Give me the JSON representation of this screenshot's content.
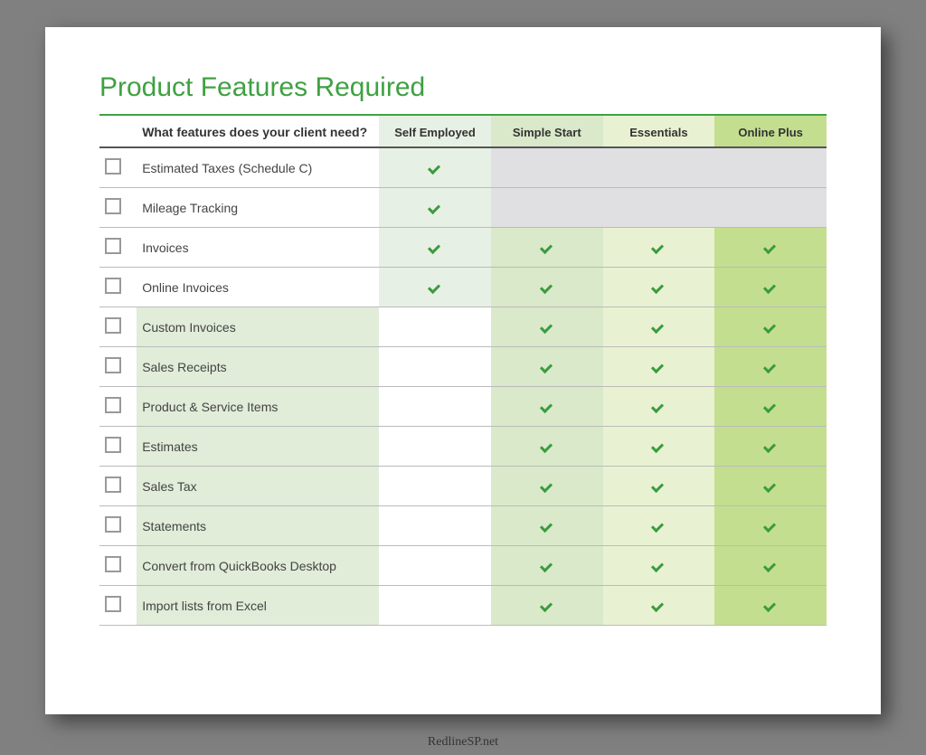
{
  "title": "Product Features Required",
  "question_header": "What features does your client need?",
  "plans": [
    "Self Employed",
    "Simple Start",
    "Essentials",
    "Online Plus"
  ],
  "features": [
    {
      "name": "Estimated Taxes (Schedule C)",
      "self": true,
      "simple": false,
      "essential": false,
      "plus": false,
      "grayAfterSelf": true,
      "featBg": false
    },
    {
      "name": "Mileage Tracking",
      "self": true,
      "simple": false,
      "essential": false,
      "plus": false,
      "grayAfterSelf": true,
      "featBg": false
    },
    {
      "name": "Invoices",
      "self": true,
      "simple": true,
      "essential": true,
      "plus": true,
      "grayAfterSelf": false,
      "featBg": false
    },
    {
      "name": "Online Invoices",
      "self": true,
      "simple": true,
      "essential": true,
      "plus": true,
      "grayAfterSelf": false,
      "featBg": false
    },
    {
      "name": "Custom Invoices",
      "self": false,
      "simple": true,
      "essential": true,
      "plus": true,
      "grayAfterSelf": false,
      "featBg": true
    },
    {
      "name": "Sales Receipts",
      "self": false,
      "simple": true,
      "essential": true,
      "plus": true,
      "grayAfterSelf": false,
      "featBg": true
    },
    {
      "name": "Product & Service Items",
      "self": false,
      "simple": true,
      "essential": true,
      "plus": true,
      "grayAfterSelf": false,
      "featBg": true
    },
    {
      "name": "Estimates",
      "self": false,
      "simple": true,
      "essential": true,
      "plus": true,
      "grayAfterSelf": false,
      "featBg": true
    },
    {
      "name": "Sales Tax",
      "self": false,
      "simple": true,
      "essential": true,
      "plus": true,
      "grayAfterSelf": false,
      "featBg": true
    },
    {
      "name": "Statements",
      "self": false,
      "simple": true,
      "essential": true,
      "plus": true,
      "grayAfterSelf": false,
      "featBg": true
    },
    {
      "name": "Convert from QuickBooks Desktop",
      "self": false,
      "simple": true,
      "essential": true,
      "plus": true,
      "grayAfterSelf": false,
      "featBg": true
    },
    {
      "name": "Import lists from Excel",
      "self": false,
      "simple": true,
      "essential": true,
      "plus": true,
      "grayAfterSelf": false,
      "featBg": true
    }
  ],
  "watermark": "RedlineSP.net"
}
